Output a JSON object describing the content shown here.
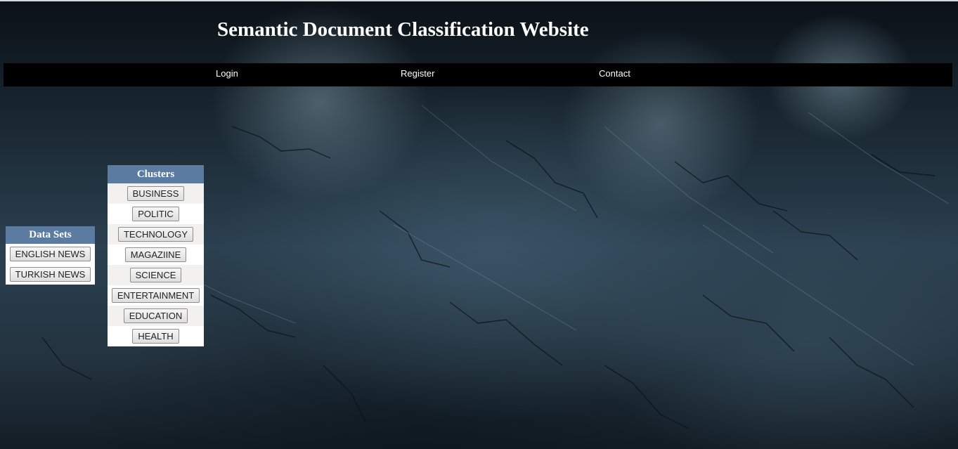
{
  "header": {
    "title": "Semantic Document Classification Website"
  },
  "nav": {
    "items": [
      {
        "label": "Login"
      },
      {
        "label": "Register"
      },
      {
        "label": "Contact"
      }
    ]
  },
  "clusters": {
    "title": "Clusters",
    "items": [
      {
        "label": "BUSINESS"
      },
      {
        "label": "POLITIC"
      },
      {
        "label": "TECHNOLOGY"
      },
      {
        "label": "MAGAZIINE"
      },
      {
        "label": "SCIENCE"
      },
      {
        "label": "ENTERTAINMENT"
      },
      {
        "label": "EDUCATION"
      },
      {
        "label": "HEALTH"
      }
    ]
  },
  "datasets": {
    "title": "Data Sets",
    "items": [
      {
        "label": "ENGLISH NEWS"
      },
      {
        "label": "TURKISH NEWS"
      }
    ]
  },
  "colors": {
    "navbar": "#000000",
    "panel_header": "#5b7ca0",
    "panel_row_alt": "#f3f1ee",
    "background": "#2b4050"
  }
}
